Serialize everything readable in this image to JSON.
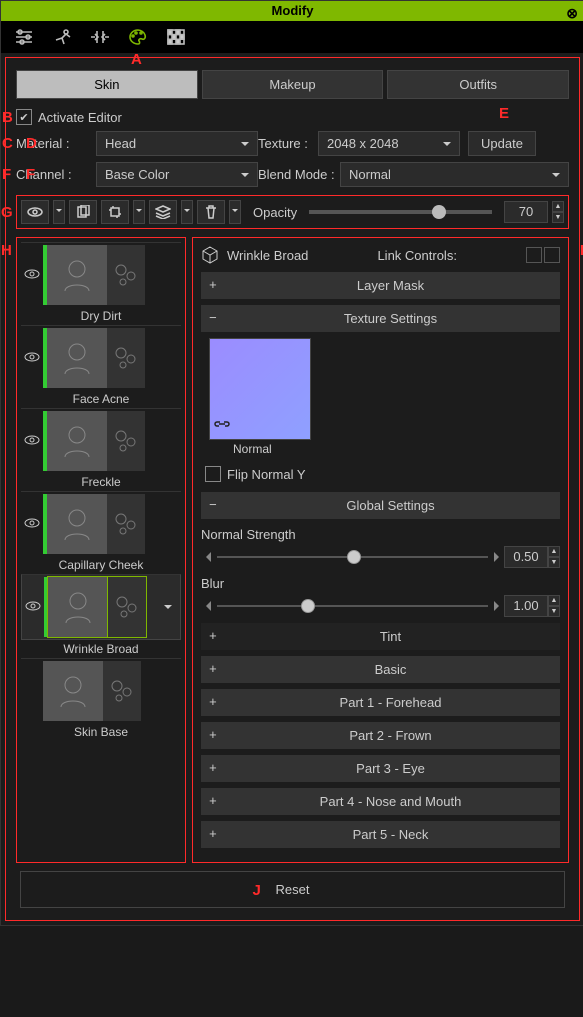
{
  "title": "Modify",
  "mainTabs": {
    "skin": "Skin",
    "makeup": "Makeup",
    "outfits": "Outfits"
  },
  "activate": "Activate Editor",
  "material": {
    "label": "Material :",
    "value": "Head"
  },
  "texture": {
    "label": "Texture :",
    "value": "2048 x 2048"
  },
  "update": "Update",
  "channel": {
    "label": "Channel :",
    "value": "Base Color"
  },
  "blend": {
    "label": "Blend Mode :",
    "value": "Normal"
  },
  "opacity": {
    "label": "Opacity",
    "value": "70",
    "percent": 70
  },
  "layers": [
    {
      "name": "Dry Dirt",
      "eye": true,
      "stripe": true
    },
    {
      "name": "Face Acne",
      "eye": true,
      "stripe": true
    },
    {
      "name": "Freckle",
      "eye": true,
      "stripe": true
    },
    {
      "name": "Capillary Cheek",
      "eye": true,
      "stripe": true
    },
    {
      "name": "Wrinkle Broad",
      "eye": true,
      "stripe": true,
      "selected": true
    },
    {
      "name": "Skin Base",
      "eye": false,
      "stripe": false
    }
  ],
  "props": {
    "title": "Wrinkle Broad",
    "linkLabel": "Link Controls:",
    "sections": {
      "layerMask": "Layer Mask",
      "textureSettings": "Texture Settings",
      "normalCaption": "Normal",
      "flipNormal": "Flip Normal Y",
      "globalSettings": "Global Settings",
      "normalStrength": {
        "label": "Normal Strength",
        "value": "0.50",
        "percent": 50
      },
      "blur": {
        "label": "Blur",
        "value": "1.00",
        "percent": 33
      },
      "tint": "Tint",
      "basic": "Basic",
      "part1": "Part 1 - Forehead",
      "part2": "Part 2 - Frown",
      "part3": "Part 3 - Eye",
      "part4": "Part 4 - Nose and Mouth",
      "part5": "Part 5 - Neck"
    }
  },
  "reset": "Reset",
  "annots": {
    "A": "A",
    "B": "B",
    "C": "C",
    "D": "D",
    "E": "E",
    "F1": "F",
    "F2": "F",
    "G": "G",
    "H": "H",
    "I": "I",
    "J": "J"
  }
}
